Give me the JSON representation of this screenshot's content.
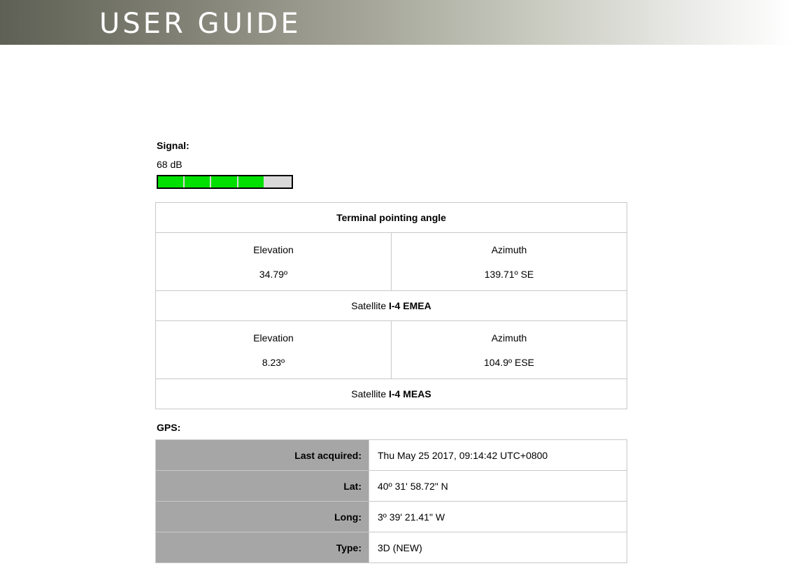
{
  "banner": {
    "title": "USER GUIDE"
  },
  "signal": {
    "title": "Signal:",
    "value": "68 dB",
    "bar_level_segments": 4,
    "bar_total_segments": 5,
    "bar_color": "#00e000"
  },
  "pointing": {
    "header": "Terminal pointing angle",
    "terminal": {
      "elevation_label": "Elevation",
      "elevation_value": "34.79º",
      "azimuth_label": "Azimuth",
      "azimuth_value": "139.71º SE"
    },
    "satellite1": {
      "prefix": "Satellite ",
      "name": "I-4 EMEA",
      "elevation_label": "Elevation",
      "elevation_value": "8.23º",
      "azimuth_label": "Azimuth",
      "azimuth_value": "104.9º ESE"
    },
    "satellite2": {
      "prefix": "Satellite ",
      "name": "I-4 MEAS"
    }
  },
  "gps": {
    "title": "GPS:",
    "rows": [
      {
        "key": "Last acquired:",
        "value": "Thu May 25 2017, 09:14:42 UTC+0800"
      },
      {
        "key": "Lat:",
        "value": "40º 31' 58.72\" N"
      },
      {
        "key": "Long:",
        "value": "3º 39' 21.41\" W"
      },
      {
        "key": "Type:",
        "value": "3D (NEW)"
      }
    ]
  }
}
